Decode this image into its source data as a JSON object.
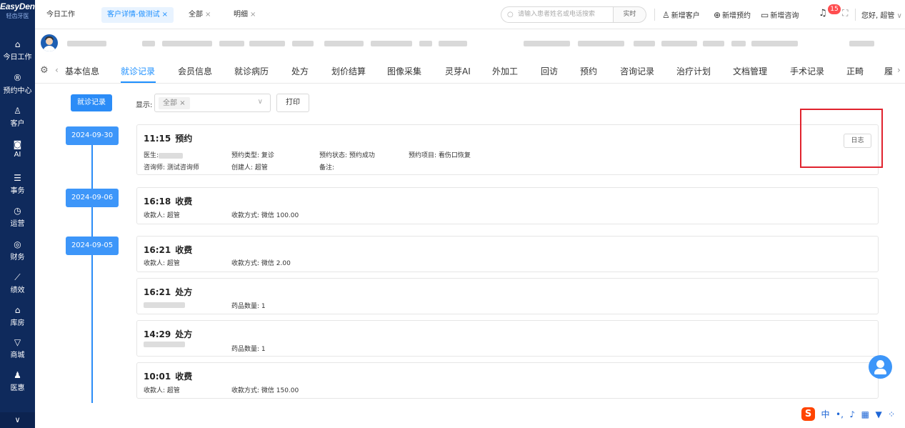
{
  "sidebar": {
    "logo": "EasyDent",
    "logo_sub": "轻齿牙医",
    "items": [
      {
        "label": "今日工作",
        "icon": "home-icon",
        "glyph": "⌂"
      },
      {
        "label": "预约中心",
        "icon": "calendar-icon",
        "glyph": "®"
      },
      {
        "label": "客户",
        "icon": "user-icon",
        "glyph": "♙"
      },
      {
        "label": "AI",
        "icon": "robot-icon",
        "glyph": "◙"
      },
      {
        "label": "事务",
        "icon": "clipboard-icon",
        "glyph": "☰"
      },
      {
        "label": "运营",
        "icon": "clock-icon",
        "glyph": "◷"
      },
      {
        "label": "财务",
        "icon": "money-icon",
        "glyph": "◎"
      },
      {
        "label": "绩效",
        "icon": "chart-icon",
        "glyph": "⟋"
      },
      {
        "label": "库房",
        "icon": "warehouse-icon",
        "glyph": "⌂"
      },
      {
        "label": "商城",
        "icon": "cart-icon",
        "glyph": "▽"
      },
      {
        "label": "医惠",
        "icon": "people-icon",
        "glyph": "♟"
      }
    ],
    "collapse_glyph": "∨"
  },
  "topbar": {
    "tabs": [
      {
        "label": "今日工作",
        "closable": false
      },
      {
        "label": "客户详情-做测试",
        "closable": true,
        "active": true
      },
      {
        "label": "全部",
        "closable": true
      },
      {
        "label": "明细",
        "closable": true
      }
    ],
    "close_glyph": "×",
    "search_placeholder": "请输入患者姓名或电话搜索",
    "search_button": "实时",
    "actions": [
      {
        "label": "新增客户",
        "icon": "add-user-icon",
        "glyph": "♙"
      },
      {
        "label": "新增预约",
        "icon": "add-appointment-icon",
        "glyph": "⊕"
      },
      {
        "label": "新增咨询",
        "icon": "chat-icon",
        "glyph": "▭"
      }
    ],
    "notification_count": "15",
    "greeting": "您好, 超管",
    "greeting_caret": "∨"
  },
  "subtabs": {
    "items": [
      "基本信息",
      "就诊记录",
      "会员信息",
      "就诊病历",
      "处方",
      "划价结算",
      "图像采集",
      "灵芽AI",
      "外加工",
      "回访",
      "预约",
      "咨询记录",
      "治疗计划",
      "文档管理",
      "手术记录",
      "正畸",
      "履"
    ],
    "active_index": 1
  },
  "filters": {
    "visit_button": "就诊记录",
    "show_label": "显示:",
    "chip_label": "全部",
    "print_button": "打印"
  },
  "timeline": {
    "dates": [
      "2024-09-30",
      "2024-09-06",
      "2024-09-05"
    ],
    "records": [
      {
        "time": "11:15",
        "type": "预约",
        "fields": {
          "doctor": "医生:",
          "appt_type": "预约类型: 复诊",
          "appt_status": "预约状态: 预约成功",
          "appt_item": "预约项目: 看伤口恢复",
          "consultant": "咨询师: 测试咨询师",
          "creator": "创建人: 超管",
          "remark": "备注:"
        },
        "log_button": "日志"
      },
      {
        "time": "16:18",
        "type": "收费",
        "payee": "收款人: 超管",
        "method": "收款方式: 微信 100.00"
      },
      {
        "time": "16:21",
        "type": "收费",
        "payee": "收款人: 超管",
        "method": "收款方式: 微信 2.00"
      },
      {
        "time": "16:21",
        "type": "处方",
        "drug_count": "药品数量: 1"
      },
      {
        "time": "14:29",
        "type": "处方",
        "drug_count": "药品数量: 1"
      },
      {
        "time": "10:01",
        "type": "收费",
        "payee": "收款人: 超管",
        "method": "收款方式: 微信 150.00"
      }
    ]
  },
  "ime": {
    "logo": "S",
    "lang": "中"
  },
  "colors": {
    "sidebar": "#0f2a5c",
    "accent": "#1e90ff",
    "date_pill": "#3d96f9",
    "highlight_box": "#e0232e"
  }
}
